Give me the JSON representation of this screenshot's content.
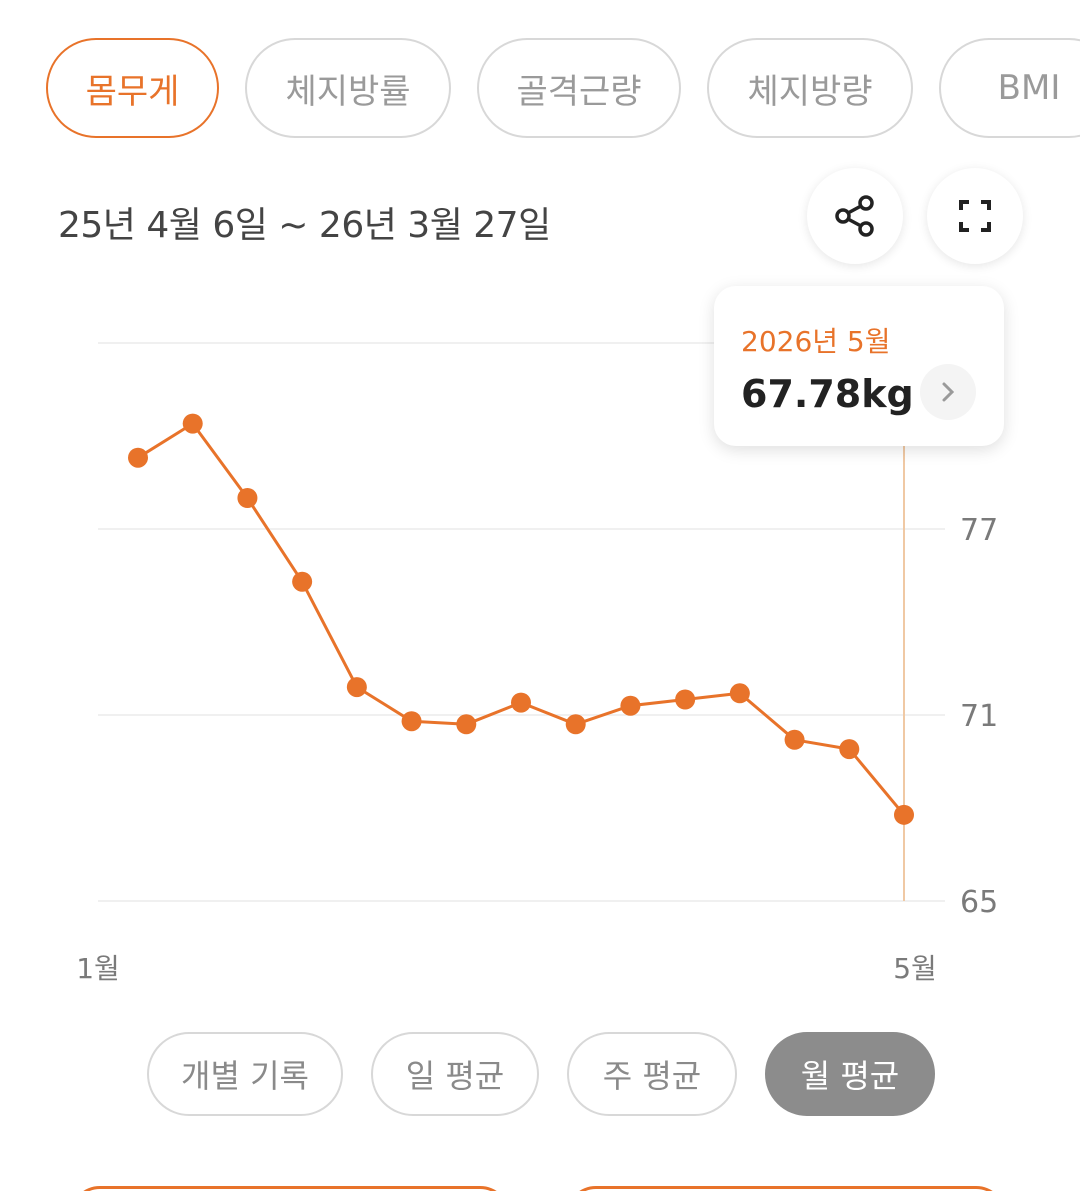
{
  "metric_tabs": [
    {
      "label": "몸무게",
      "active": true
    },
    {
      "label": "체지방률",
      "active": false
    },
    {
      "label": "골격근량",
      "active": false
    },
    {
      "label": "체지방량",
      "active": false
    },
    {
      "label": "BMI",
      "active": false
    }
  ],
  "date_range": "25년 4월 6일 ~ 26년 3월 27일",
  "icons": {
    "share": "share-icon",
    "expand": "expand-icon",
    "tooltip_arrow": "chevron-right-icon"
  },
  "tooltip": {
    "date": "2026년 5월",
    "value": "67.78kg"
  },
  "view_modes": [
    {
      "label": "개별 기록",
      "active": false
    },
    {
      "label": "일 평균",
      "active": false
    },
    {
      "label": "주 평균",
      "active": false
    },
    {
      "label": "월 평균",
      "active": true
    }
  ],
  "colors": {
    "accent": "#e8732a",
    "inactive_text": "#9a9a9a",
    "active_mode_bg": "#8c8c8c"
  },
  "chart_data": {
    "type": "line",
    "title": "",
    "xlabel": "",
    "ylabel": "",
    "x_tick_labels": [
      "1월",
      "5월"
    ],
    "y_ticks": [
      65,
      71,
      77
    ],
    "ylim": [
      65,
      83
    ],
    "grid": true,
    "series": [
      {
        "values": [
          79.3,
          80.4,
          78.0,
          75.3,
          71.9,
          70.8,
          70.7,
          71.4,
          70.7,
          71.3,
          71.5,
          71.7,
          70.2,
          69.9,
          67.78
        ]
      }
    ],
    "highlight_index": 14
  }
}
